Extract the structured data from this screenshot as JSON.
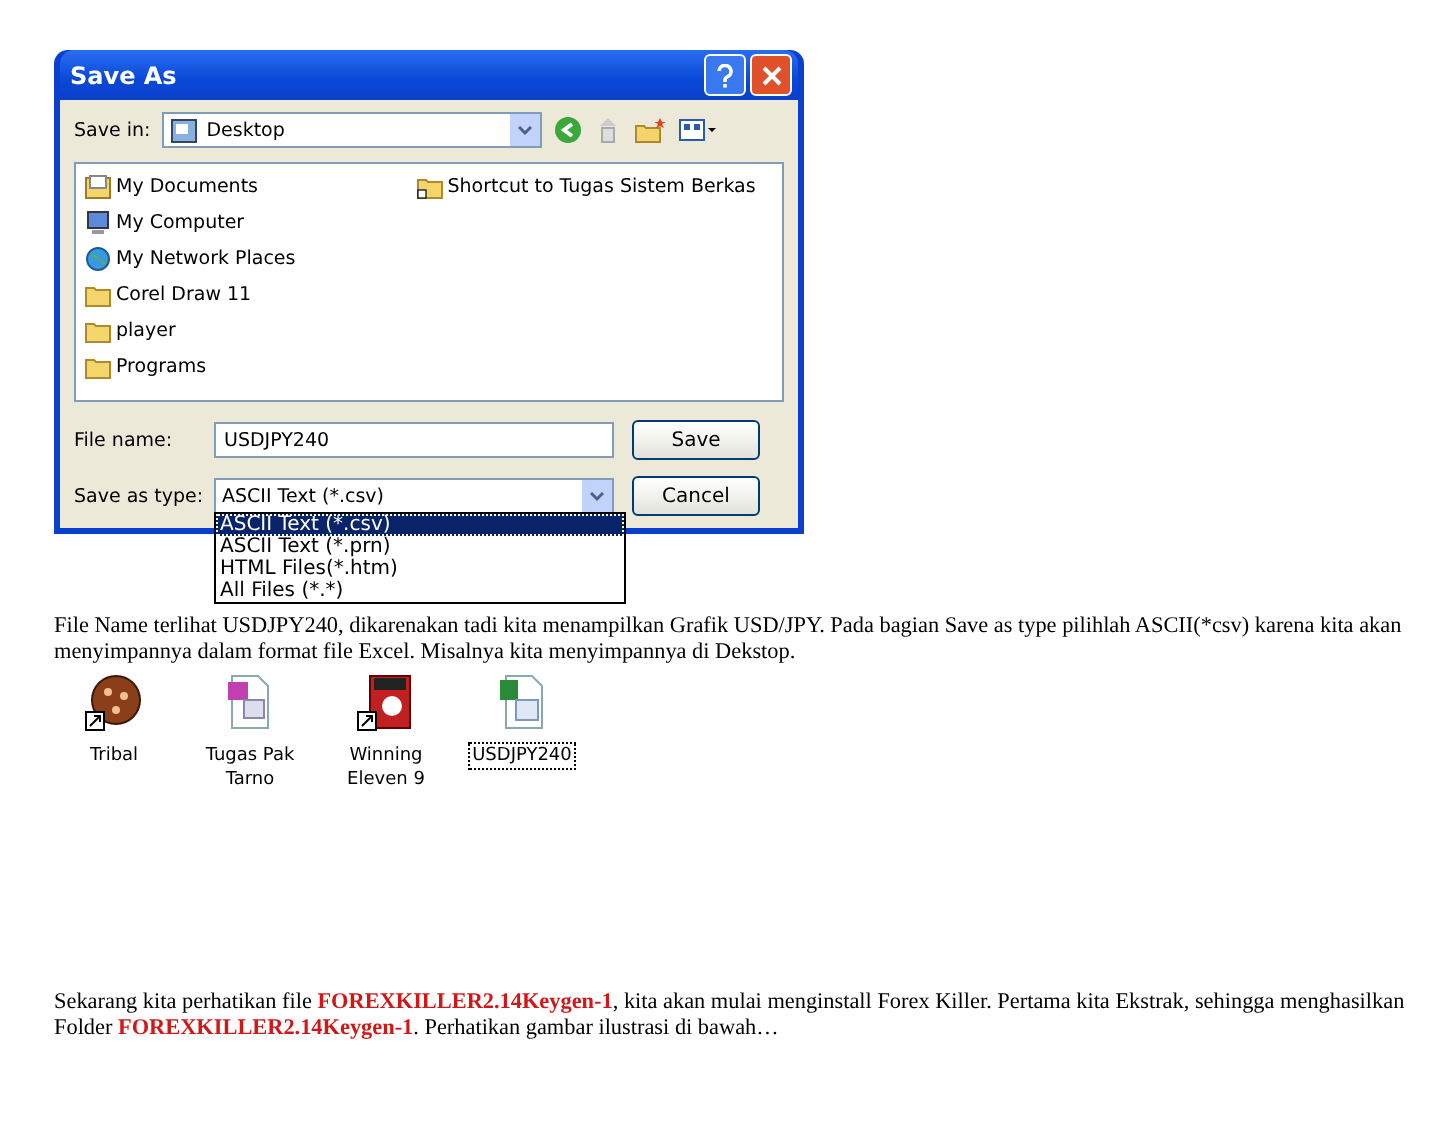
{
  "dialog": {
    "title": "Save As",
    "save_in_label": "Save in:",
    "location": "Desktop",
    "files": [
      {
        "name": "My Documents",
        "kind": "documents"
      },
      {
        "name": "My Computer",
        "kind": "computer"
      },
      {
        "name": "My Network Places",
        "kind": "network"
      },
      {
        "name": "Corel Draw 11",
        "kind": "folder"
      },
      {
        "name": "player",
        "kind": "folder"
      },
      {
        "name": "Programs",
        "kind": "folder"
      },
      {
        "name": "Shortcut to Tugas Sistem Berkas",
        "kind": "shortcut"
      }
    ],
    "file_name_label": "File name:",
    "file_name": "USDJPY240",
    "save_type_label": "Save as type:",
    "save_type": "ASCII Text (*.csv)",
    "buttons": [
      "Save",
      "Cancel"
    ],
    "type_options": [
      {
        "label": "ASCII Text (*.csv)",
        "selected": true
      },
      {
        "label": "ASCII Text (*.prn)",
        "selected": false
      },
      {
        "label": "HTML Files(*.htm)",
        "selected": false
      },
      {
        "label": "All Files (*.*)",
        "selected": false
      }
    ]
  },
  "paragraph_1": "File Name terlihat USDJPY240, dikarenakan tadi kita menampilkan Grafik USD/JPY. Pada bagian Save as type pilihlah ASCII(*csv) karena kita akan menyimpannya dalam format file Excel. Misalnya kita menyimpannya di Dekstop.",
  "desktop_icons": [
    {
      "label": "Tribal",
      "kind": "game",
      "selected": false
    },
    {
      "label": "Tugas Pak Tarno",
      "kind": "document",
      "selected": false
    },
    {
      "label": "Winning Eleven 9",
      "kind": "soccer",
      "selected": false
    },
    {
      "label": "USDJPY240",
      "kind": "spreadsheet",
      "selected": true
    }
  ],
  "paragraph_2": "Sekarang kita perhatikan file **FOREXKILLER2.14Keygen-1**, kita akan mulai menginstall Forex Killer. Pertama kita Ekstrak, sehingga menghasilkan Folder **FOREXKILLER2.14Keygen-1**. Perhatikan gambar ilustrasi di bawah…"
}
